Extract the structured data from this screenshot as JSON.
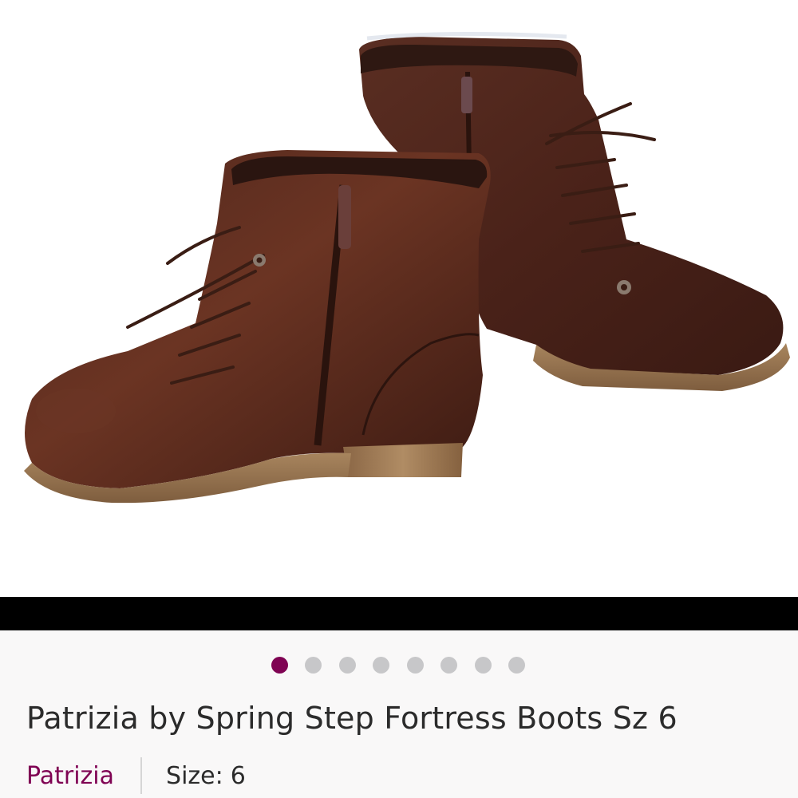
{
  "listing": {
    "title": "Patrizia by Spring Step Fortress Boots Sz 6",
    "brand": "Patrizia",
    "size_label": "Size:",
    "size_value": "6"
  },
  "gallery": {
    "dot_count": 8,
    "active_index": 0,
    "image_subject": "pair of brown lace-up ankle boots"
  },
  "colors": {
    "accent": "#7f0353",
    "inactive_dot": "#c7c7c9",
    "text": "#2b2b2b",
    "band": "#000000"
  }
}
